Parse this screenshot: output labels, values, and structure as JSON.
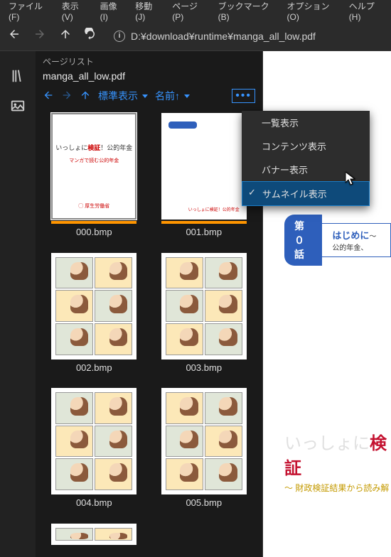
{
  "menubar": {
    "file": "ファイル(F)",
    "view": "表示(V)",
    "image": "画像(I)",
    "move": "移動(J)",
    "page": "ページ(P)",
    "bookmark": "ブックマーク(B)",
    "options": "オプション(O)",
    "help": "ヘルプ(H)"
  },
  "url": "D:¥download¥runtime¥manga_all_low.pdf",
  "panel": {
    "header": "ページリスト",
    "docTitle": "manga_all_low.pdf",
    "displayMode": "標準表示",
    "sortMode": "名前↑"
  },
  "thumbs": [
    {
      "label": "000.bmp",
      "selected": true,
      "kind": "cover",
      "bar": true
    },
    {
      "label": "001.bmp",
      "selected": false,
      "kind": "blank",
      "bar": true
    },
    {
      "label": "002.bmp",
      "selected": false,
      "kind": "manga",
      "bar": false
    },
    {
      "label": "003.bmp",
      "selected": false,
      "kind": "manga",
      "bar": false
    },
    {
      "label": "004.bmp",
      "selected": false,
      "kind": "manga",
      "bar": false
    },
    {
      "label": "005.bmp",
      "selected": false,
      "kind": "manga",
      "bar": false
    }
  ],
  "coverText": {
    "prefix": "いっしょに",
    "highlight": "検証",
    "suffix": "！公的年金",
    "sub": "マンガで読む公的年金",
    "logo": "厚生労働省"
  },
  "contextMenu": {
    "items": [
      {
        "label": "一覧表示",
        "checked": false,
        "selected": false
      },
      {
        "label": "コンテンツ表示",
        "checked": false,
        "selected": false
      },
      {
        "label": "バナー表示",
        "checked": false,
        "selected": false
      },
      {
        "label": "サムネイル表示",
        "checked": true,
        "selected": true
      }
    ]
  },
  "mainPage": {
    "chapterPill": "第０話",
    "chapterTitle": "はじめに",
    "chapterSub": "～公的年金、",
    "bigPrefix": "いっしょに",
    "bigHighlight": "検証",
    "bigSub": "～ 財政検証結果から読み解"
  }
}
